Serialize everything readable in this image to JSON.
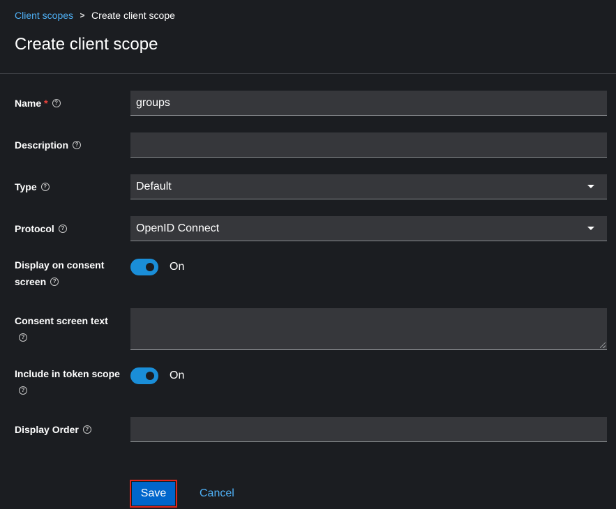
{
  "breadcrumb": {
    "parent": "Client scopes",
    "separator": ">",
    "current": "Create client scope"
  },
  "page": {
    "title": "Create client scope"
  },
  "form": {
    "name": {
      "label": "Name",
      "required_mark": "*",
      "value": "groups"
    },
    "description": {
      "label": "Description",
      "value": ""
    },
    "type": {
      "label": "Type",
      "value": "Default"
    },
    "protocol": {
      "label": "Protocol",
      "value": "OpenID Connect"
    },
    "display_on_consent": {
      "label": "Display on consent screen",
      "state": "On"
    },
    "consent_screen_text": {
      "label": "Consent screen text",
      "value": ""
    },
    "include_in_token_scope": {
      "label": "Include in token scope",
      "state": "On"
    },
    "display_order": {
      "label": "Display Order",
      "value": ""
    }
  },
  "actions": {
    "save": "Save",
    "cancel": "Cancel"
  },
  "icons": {
    "help": "help-icon",
    "separator": "chevron-right-icon",
    "dropdown": "caret-down-icon"
  },
  "colors": {
    "background": "#1b1d21",
    "input_bg": "#36373b",
    "link": "#4fb1f7",
    "primary": "#0066cc",
    "toggle_on": "#1a8ed8",
    "required": "#f0443d",
    "highlight": "#e0261d"
  }
}
